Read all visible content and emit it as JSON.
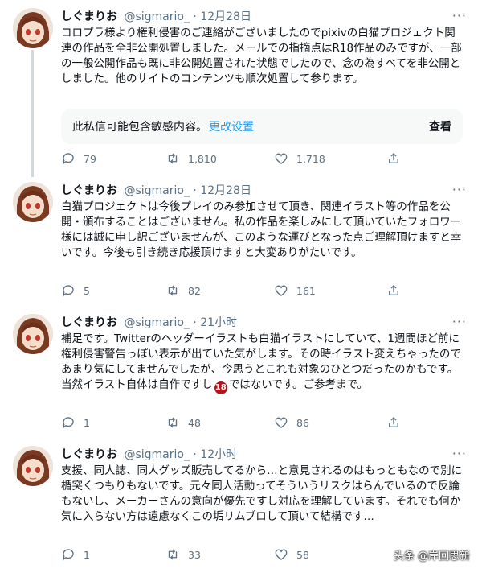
{
  "tweets": [
    {
      "name": "しぐまりお",
      "handle": "@sigmario_",
      "sep": "·",
      "time": "12月28日",
      "more": "···",
      "text": "コロプラ様より権利侵害のご連絡がございましたのでpixivの白猫プロジェクト関連の作品を全非公開処置しました。メールでの指摘点はR18作品のみですが、一部の一般公開作品も既に非公開処置された状態でしたので、念の為すべてを非公開としました。他のサイトのコンテンツも順次処置して参ります。",
      "sensitive": {
        "message": "此私信可能包含敏感内容。",
        "link": "更改设置",
        "view": "查看"
      },
      "replies": "79",
      "retweets": "1,810",
      "likes": "1,718"
    },
    {
      "name": "しぐまりお",
      "handle": "@sigmario_",
      "sep": "·",
      "time": "12月28日",
      "more": "···",
      "text": "白猫プロジェクトは今後プレイのみ参加させて頂き、関連イラスト等の作品を公開・頒布することはございません。私の作品を楽しみにして頂いていたフォロワー様には誠に申し訳ございませんが、このような運びとなった点ご理解頂けますと幸いです。今後も引き続き応援頂けますと大変ありがたいです。",
      "replies": "5",
      "retweets": "82",
      "likes": "161"
    },
    {
      "name": "しぐまりお",
      "handle": "@sigmario_",
      "sep": "·",
      "time": "21小时",
      "more": "···",
      "text_before": "補足です。Twitterのヘッダーイラストも白猫イラストにしていて、1週間ほど前に権利侵害警告っぽい表示が出ていた気がします。その時イラスト変えちゃったのであまり気にしてませんでしたが、今思うとこれも対象のひとつだったのかもです。当然イラスト自体は自作ですし",
      "badge": "18",
      "text_after": "ではないです。ご参考まで。",
      "replies": "1",
      "retweets": "48",
      "likes": "86"
    },
    {
      "name": "しぐまりお",
      "handle": "@sigmario_",
      "sep": "·",
      "time": "12小时",
      "more": "···",
      "text": "支援、同人誌、同人グッズ販売してるから…と意見されるのはもっともなので別に楯突くつもりもないです。元々同人活動ってそういうリスクはらんでいるので反論もないし、メーカーさんの意向が優先ですし対応を理解しています。それでも何か気に入らない方は遠慮なくこの垢リムブロして頂いて結構です…",
      "replies": "1",
      "retweets": "33",
      "likes": "58"
    }
  ],
  "watermark": "头条 @岸回思新"
}
